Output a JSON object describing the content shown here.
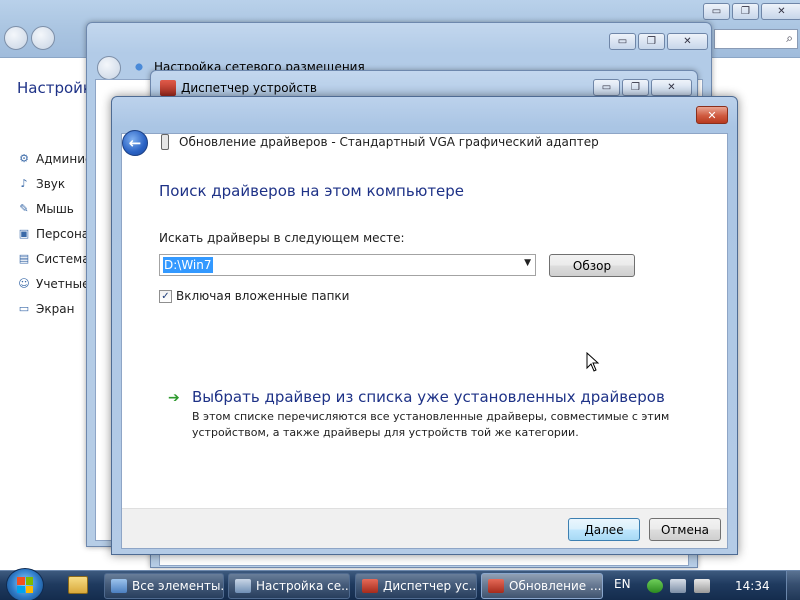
{
  "background_explorer": {
    "title": "Настройк",
    "sidebar_items": [
      {
        "label": "Админис",
        "icon": "admin-tools-icon"
      },
      {
        "label": "Звук",
        "icon": "speaker-icon"
      },
      {
        "label": "Мышь",
        "icon": "mouse-icon"
      },
      {
        "label": "Персона",
        "icon": "personalization-icon"
      },
      {
        "label": "Система",
        "icon": "system-icon"
      },
      {
        "label": "Учетные",
        "icon": "user-accounts-icon"
      },
      {
        "label": "Экран",
        "icon": "display-icon"
      }
    ],
    "caption_minimize": "▭",
    "caption_maximize": "❐",
    "caption_close": "✕",
    "search_icon_glyph": "⌕"
  },
  "network_window": {
    "title": "Настройка сетевого размещения"
  },
  "device_manager_window": {
    "title": "Диспетчер устройств"
  },
  "dialog": {
    "title": "Обновление драйверов - Стандартный VGA графический адаптер",
    "close_glyph": "✕",
    "back_glyph": "←",
    "instruction": "Поиск драйверов на этом компьютере",
    "search_label": "Искать драйверы в следующем месте:",
    "path_value": "D:\\Win7",
    "dropdown_arrow": "▼",
    "browse_button": "Обзор",
    "include_subfolders": "Включая вложенные папки",
    "include_subfolders_checked": true,
    "checkbox_glyph": "✓",
    "link_arrow": "➔",
    "pick_driver_title": "Выбрать драйвер из списка уже установленных драйверов",
    "pick_driver_desc": "В этом списке перечисляются все установленные драйверы, совместимые с этим устройством, а также драйверы для устройств той же категории.",
    "next_button": "Далее",
    "cancel_button": "Отмена"
  },
  "taskbar": {
    "buttons": [
      {
        "label": "Все элементы...",
        "icon": "control-panel-icon",
        "active": false
      },
      {
        "label": "Настройка се...",
        "icon": "network-icon",
        "active": false
      },
      {
        "label": "Диспетчер ус...",
        "icon": "device-manager-icon",
        "active": false
      },
      {
        "label": "Обновление ...",
        "icon": "driver-update-icon",
        "active": true
      }
    ],
    "language": "EN",
    "time": "14:34"
  },
  "colors": {
    "heading_blue": "#1e3287",
    "selection_blue": "#3399ff",
    "link_green": "#2e9a2e",
    "taskbar": "#1f3a5f"
  }
}
